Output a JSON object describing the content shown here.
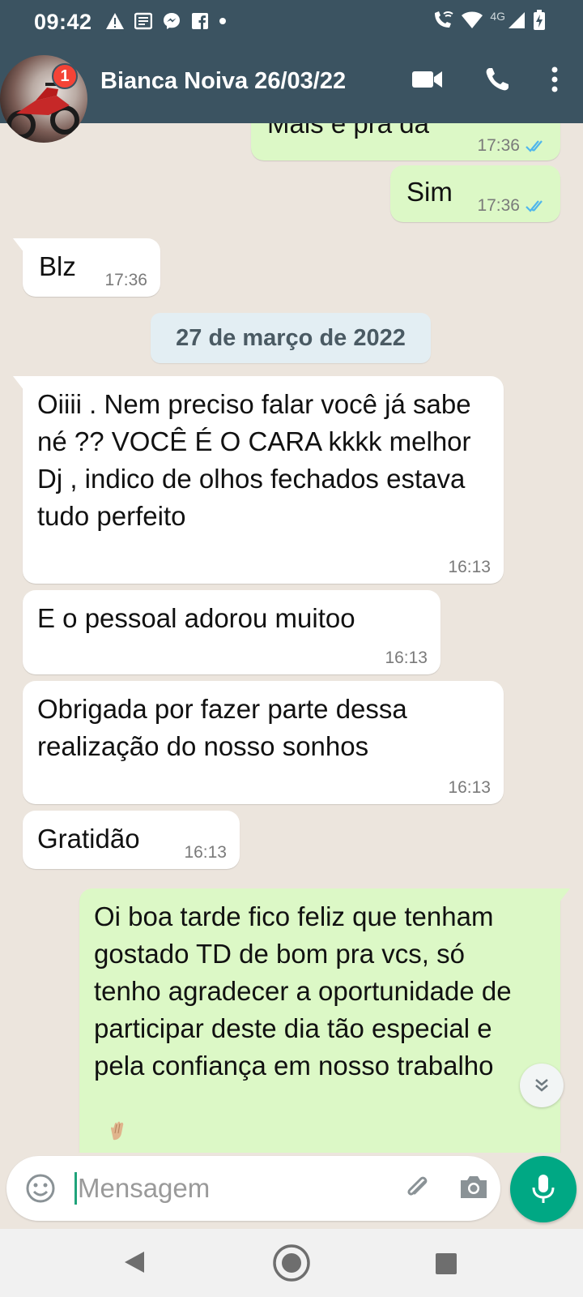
{
  "status_bar": {
    "time": "09:42",
    "network": "4G"
  },
  "header": {
    "contact_name": "Bianca Noiva 26/03/22",
    "unread_badge": "1"
  },
  "messages": [
    {
      "text": "Mais é pra da",
      "time": "17:36",
      "direction": "out",
      "read": true
    },
    {
      "text": "Sim",
      "time": "17:36",
      "direction": "out",
      "read": true
    },
    {
      "text": "Blz",
      "time": "17:36",
      "direction": "in"
    },
    {
      "text": "Oiiii . Nem preciso falar você já sabe né ?? VOCÊ É O CARA kkkk melhor Dj , indico de olhos fechados estava tudo perfeito",
      "time": "16:13",
      "direction": "in"
    },
    {
      "text": "E o pessoal adorou muitoo",
      "time": "16:13",
      "direction": "in"
    },
    {
      "text": "Obrigada por fazer parte dessa realização do nosso sonhos",
      "time": "16:13",
      "direction": "in"
    },
    {
      "text": "Gratidão",
      "time": "16:13",
      "direction": "in"
    },
    {
      "text": "Oi boa tarde fico feliz que tenham gostado TD de bom pra vcs, só tenho agradecer a oportunidade de participar deste dia tão especial e pela confiança em nosso trabalho",
      "direction": "out"
    }
  ],
  "date_separator": "27 de março de 2022",
  "composer": {
    "placeholder": "Mensagem"
  },
  "colors": {
    "header_bg": "#3b5361",
    "chat_bg": "#ece5dd",
    "outgoing_bubble": "#dcf8c6",
    "incoming_bubble": "#ffffff",
    "read_ticks": "#4fb6ec",
    "mic_button": "#00a884",
    "badge": "#f44336"
  },
  "icons": [
    "alert-icon",
    "news-icon",
    "messenger-icon",
    "facebook-icon",
    "dot-icon",
    "wifi-call-icon",
    "wifi-icon",
    "signal-icon",
    "battery-charging-icon",
    "video-call-icon",
    "voice-call-icon",
    "more-vert-icon",
    "double-check-icon",
    "scroll-down-icon",
    "emoji-icon",
    "attach-icon",
    "camera-icon",
    "mic-icon",
    "nav-back-icon",
    "nav-home-icon",
    "nav-recent-icon"
  ]
}
